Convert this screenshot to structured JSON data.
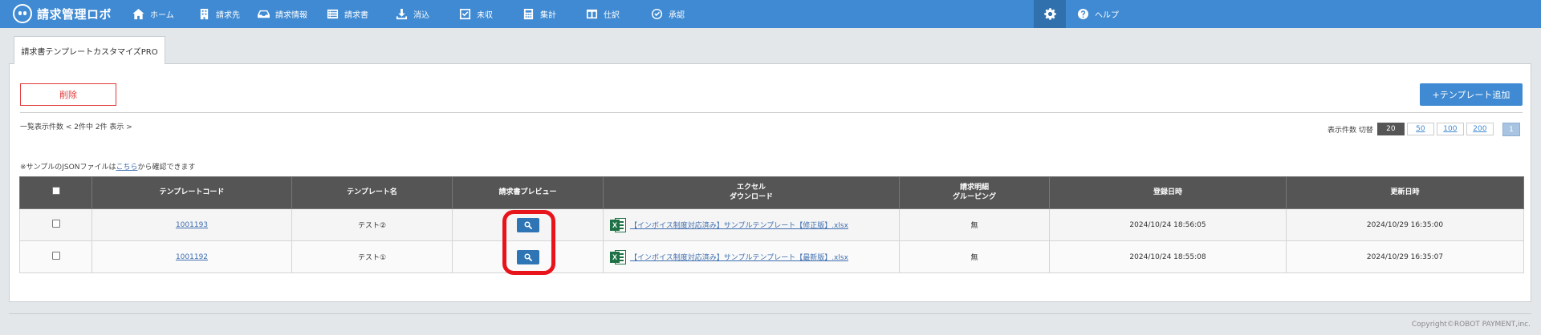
{
  "app": {
    "logo_text": "請求管理ロボ"
  },
  "nav": {
    "items": [
      {
        "label": "ホーム",
        "icon": "home-icon"
      },
      {
        "label": "請求先",
        "icon": "building-icon"
      },
      {
        "label": "請求情報",
        "icon": "inbox-icon"
      },
      {
        "label": "請求書",
        "icon": "list-icon"
      },
      {
        "label": "消込",
        "icon": "download-icon"
      },
      {
        "label": "未収",
        "icon": "check-square-icon"
      },
      {
        "label": "集計",
        "icon": "calculator-icon"
      },
      {
        "label": "仕訳",
        "icon": "columns-icon"
      },
      {
        "label": "承認",
        "icon": "check-circle-icon"
      }
    ],
    "help_label": "ヘルプ"
  },
  "tab": {
    "label": "請求書テンプレートカスタマイズPRO"
  },
  "toolbar": {
    "delete_label": "削除",
    "add_label": "+テンプレート追加"
  },
  "list": {
    "count_text": "一覧表示件数 < 2件中 2件 表示 >",
    "page_size_label": "表示件数 切替",
    "page_sizes": [
      "20",
      "50",
      "100",
      "200"
    ],
    "page_size_selected": "20",
    "current_page": "1",
    "note_prefix": "※サンプルのJSONファイルは",
    "note_link": "こちら",
    "note_suffix": "から確認できます"
  },
  "table": {
    "headers": {
      "code": "テンプレートコード",
      "name": "テンプレート名",
      "preview": "請求書プレビュー",
      "excel_1": "エクセル",
      "excel_2": "ダウンロード",
      "grouping_1": "請求明細",
      "grouping_2": "グルーピング",
      "created": "登録日時",
      "updated": "更新日時"
    },
    "rows": [
      {
        "code": "1001193",
        "name": "テスト②",
        "file": "【インボイス制度対応済み】サンプルテンプレート【修正版】.xlsx",
        "grouping": "無",
        "created": "2024/10/24 18:56:05",
        "updated": "2024/10/29 16:35:00"
      },
      {
        "code": "1001192",
        "name": "テスト①",
        "file": "【インボイス制度対応済み】サンプルテンプレート【最新版】.xlsx",
        "grouping": "無",
        "created": "2024/10/24 18:55:08",
        "updated": "2024/10/29 16:35:07"
      }
    ]
  },
  "footer": {
    "copyright": "Copyright©ROBOT PAYMENT,inc."
  },
  "colors": {
    "brand": "#3f8ad2",
    "header_dark": "#555555",
    "danger": "#e23a3a",
    "highlight": "#e8141b",
    "excel_green": "#1e7145"
  }
}
